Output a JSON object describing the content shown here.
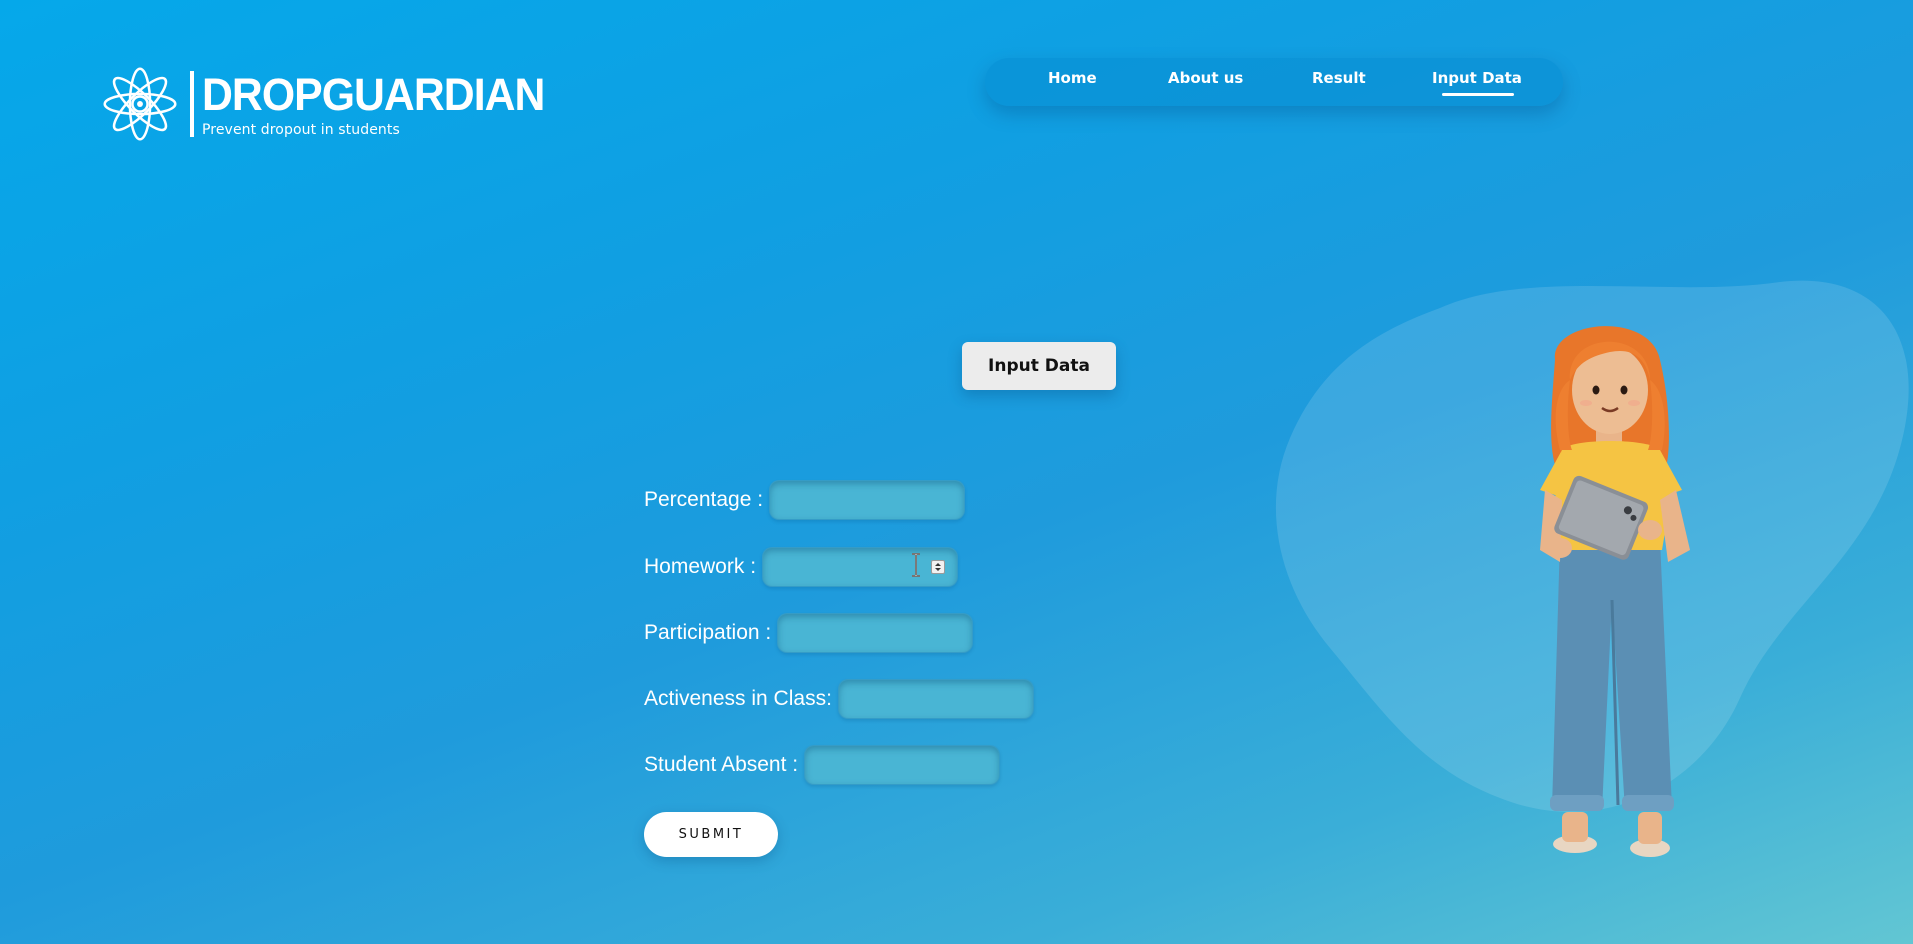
{
  "brand": {
    "name": "DROPGUARDIAN",
    "tagline": "Prevent dropout in students",
    "logo_icon": "flower-icon"
  },
  "nav": {
    "items": [
      {
        "label": "Home",
        "active": false
      },
      {
        "label": "About us",
        "active": false
      },
      {
        "label": "Result",
        "active": false
      },
      {
        "label": "Input Data",
        "active": true
      }
    ]
  },
  "page": {
    "title": "Input Data"
  },
  "form": {
    "fields": [
      {
        "label": "Percentage :",
        "value": ""
      },
      {
        "label": "Homework :",
        "value": ""
      },
      {
        "label": "Participation :",
        "value": ""
      },
      {
        "label": "Activeness in Class:",
        "value": ""
      },
      {
        "label": "Student Absent :",
        "value": ""
      }
    ],
    "submit_label": "SUBMIT"
  },
  "illustration": {
    "subject": "girl-with-tablet"
  },
  "colors": {
    "background_start": "#05a8ea",
    "background_end": "#62c6d3",
    "input_fill": "#49b5d4",
    "button_fill": "#ffffff",
    "hair": "#e8762a",
    "shirt": "#f5c443",
    "jeans": "#5b8fb4"
  }
}
